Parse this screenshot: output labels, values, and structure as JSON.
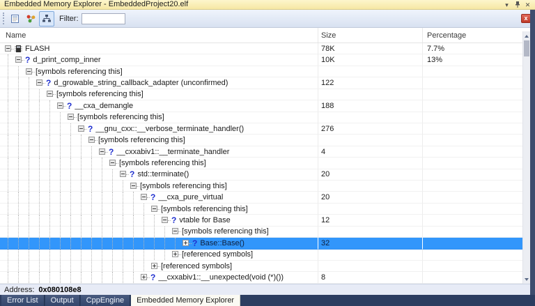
{
  "window": {
    "title": "Embedded Memory Explorer - EmbeddedProject20.elf",
    "titlebar_buttons": [
      "window-position-icon",
      "pin-icon",
      "close-icon"
    ]
  },
  "toolbar": {
    "buttons": [
      "report-icon",
      "symbol-graph-icon",
      "tree-view-icon"
    ],
    "selected_button": "tree-view-icon",
    "filter_label": "Filter:",
    "filter_value": "",
    "clear_button": "x"
  },
  "columns": {
    "name": "Name",
    "size": "Size",
    "percentage": "Percentage"
  },
  "tree": {
    "rows": [
      {
        "level": 0,
        "expander": "expanded",
        "icon": "memory-chip",
        "name": "FLASH",
        "size": "78K",
        "percentage": "7.7%",
        "selected": false
      },
      {
        "level": 1,
        "expander": "expanded",
        "icon": "question",
        "name": "d_print_comp_inner",
        "size": "10K",
        "percentage": "13%",
        "selected": false
      },
      {
        "level": 2,
        "expander": "expanded",
        "icon": null,
        "name": "[symbols referencing this]",
        "size": "",
        "percentage": "",
        "selected": false
      },
      {
        "level": 3,
        "expander": "expanded",
        "icon": "question",
        "name": "d_growable_string_callback_adapter (unconfirmed)",
        "size": "122",
        "percentage": "",
        "selected": false
      },
      {
        "level": 4,
        "expander": "expanded",
        "icon": null,
        "name": "[symbols referencing this]",
        "size": "",
        "percentage": "",
        "selected": false
      },
      {
        "level": 5,
        "expander": "expanded",
        "icon": "question",
        "name": "__cxa_demangle",
        "size": "188",
        "percentage": "",
        "selected": false
      },
      {
        "level": 6,
        "expander": "expanded",
        "icon": null,
        "name": "[symbols referencing this]",
        "size": "",
        "percentage": "",
        "selected": false
      },
      {
        "level": 7,
        "expander": "expanded",
        "icon": "question",
        "name": "__gnu_cxx::__verbose_terminate_handler()",
        "size": "276",
        "percentage": "",
        "selected": false
      },
      {
        "level": 8,
        "expander": "expanded",
        "icon": null,
        "name": "[symbols referencing this]",
        "size": "",
        "percentage": "",
        "selected": false
      },
      {
        "level": 9,
        "expander": "expanded",
        "icon": "question",
        "name": "__cxxabiv1::__terminate_handler",
        "size": "4",
        "percentage": "",
        "selected": false
      },
      {
        "level": 10,
        "expander": "expanded",
        "icon": null,
        "name": "[symbols referencing this]",
        "size": "",
        "percentage": "",
        "selected": false
      },
      {
        "level": 11,
        "expander": "expanded",
        "icon": "question",
        "name": "std::terminate()",
        "size": "20",
        "percentage": "",
        "selected": false
      },
      {
        "level": 12,
        "expander": "expanded",
        "icon": null,
        "name": "[symbols referencing this]",
        "size": "",
        "percentage": "",
        "selected": false
      },
      {
        "level": 13,
        "expander": "expanded",
        "icon": "question",
        "name": "__cxa_pure_virtual",
        "size": "20",
        "percentage": "",
        "selected": false
      },
      {
        "level": 14,
        "expander": "expanded",
        "icon": null,
        "name": "[symbols referencing this]",
        "size": "",
        "percentage": "",
        "selected": false
      },
      {
        "level": 15,
        "expander": "expanded",
        "icon": "question",
        "name": "vtable for Base",
        "size": "12",
        "percentage": "",
        "selected": false
      },
      {
        "level": 16,
        "expander": "expanded",
        "icon": null,
        "name": "[symbols referencing this]",
        "size": "",
        "percentage": "",
        "selected": false
      },
      {
        "level": 17,
        "expander": "collapsed",
        "icon": "question",
        "name": "Base::Base()",
        "size": "32",
        "percentage": "",
        "selected": true
      },
      {
        "level": 16,
        "expander": "collapsed",
        "icon": null,
        "name": "[referenced symbols]",
        "size": "",
        "percentage": "",
        "selected": false
      },
      {
        "level": 14,
        "expander": "collapsed",
        "icon": null,
        "name": "[referenced symbols]",
        "size": "",
        "percentage": "",
        "selected": false
      },
      {
        "level": 13,
        "expander": "collapsed",
        "icon": "question",
        "name": "__cxxabiv1::__unexpected(void (*)())",
        "size": "8",
        "percentage": "",
        "selected": false
      }
    ]
  },
  "statusbar": {
    "address_label": "Address:",
    "address_value": "0x080108e8"
  },
  "tabs": [
    {
      "label": "Error List",
      "active": false
    },
    {
      "label": "Output",
      "active": false
    },
    {
      "label": "CppEngine",
      "active": false
    },
    {
      "label": "Embedded Memory Explorer",
      "active": true
    }
  ],
  "colors": {
    "selection": "#3296fb",
    "titlebar": "#f9eeb5",
    "tabstrip": "#2c3d60",
    "question_icon": "#2030cf",
    "clear_button": "#c8442f",
    "rail": "#3e4d6e"
  }
}
